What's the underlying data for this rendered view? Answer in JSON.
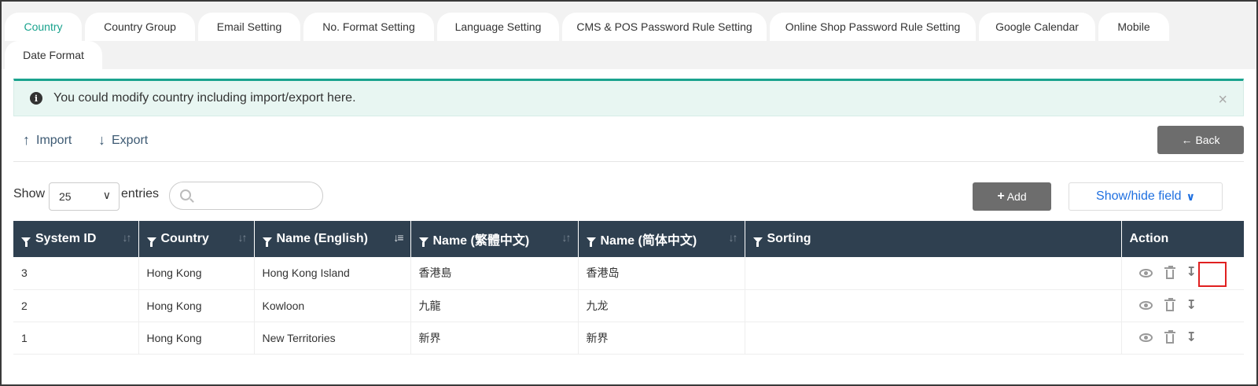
{
  "tabs": [
    {
      "label": "Country",
      "active": true
    },
    {
      "label": "Country Group"
    },
    {
      "label": "Email Setting"
    },
    {
      "label": "No. Format Setting"
    },
    {
      "label": "Language Setting"
    },
    {
      "label": "CMS & POS Password Rule Setting"
    },
    {
      "label": "Online Shop Password Rule Setting"
    },
    {
      "label": "Google Calendar"
    },
    {
      "label": "Mobile"
    },
    {
      "label": "Date Format"
    }
  ],
  "alert": {
    "text": "You could modify country including import/export here.",
    "icon": "info-icon",
    "close_icon": "×"
  },
  "toolbar": {
    "import_label": "Import",
    "export_label": "Export",
    "back_label": "Back"
  },
  "controls": {
    "show_label": "Show",
    "entries_value": "25",
    "entries_label": "entries",
    "search_placeholder": "",
    "add_label": "Add",
    "showhide_label": "Show/hide field"
  },
  "table": {
    "columns": [
      "System ID",
      "Country",
      "Name (English)",
      "Name (繁體中文)",
      "Name (简体中文)",
      "Sorting",
      "Action"
    ],
    "rows": [
      {
        "system_id": "3",
        "country": "Hong Kong",
        "name_en": "Hong Kong Island",
        "name_tc": "香港島",
        "name_sc": "香港岛",
        "sorting": ""
      },
      {
        "system_id": "2",
        "country": "Hong Kong",
        "name_en": "Kowloon",
        "name_tc": "九龍",
        "name_sc": "九龙",
        "sorting": ""
      },
      {
        "system_id": "1",
        "country": "Hong Kong",
        "name_en": "New Territories",
        "name_tc": "新界",
        "name_sc": "新界",
        "sorting": ""
      }
    ]
  },
  "colors": {
    "accent": "#1aa38e",
    "header_bg": "#2f4050",
    "button_gray": "#6d6d6d",
    "link_blue": "#1e6fe0",
    "highlight": "#e02020"
  }
}
